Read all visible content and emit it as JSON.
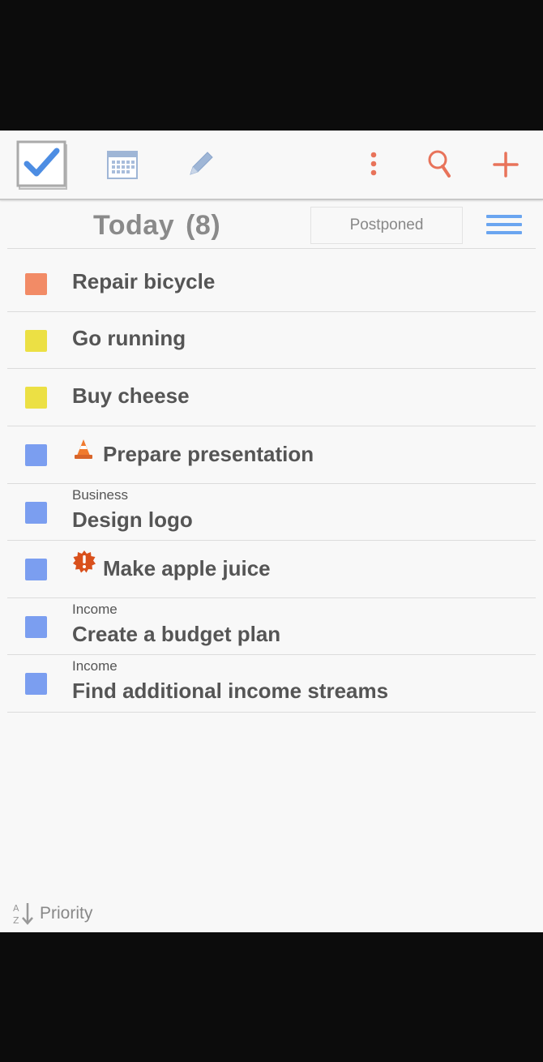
{
  "toolbar": {
    "icons": [
      "tasks-checkbox-icon",
      "calendar-icon",
      "pencil-icon",
      "more-vert-icon",
      "search-icon",
      "add-icon"
    ],
    "accent": "#e8735a"
  },
  "header": {
    "title": "Today",
    "count": "(8)",
    "postponed_label": "Postponed"
  },
  "tasks": [
    {
      "title": "Repair bicycle",
      "category": "",
      "color": "#f28b66",
      "badge": ""
    },
    {
      "title": "Go running",
      "category": "",
      "color": "#ece044",
      "badge": ""
    },
    {
      "title": "Buy cheese",
      "category": "",
      "color": "#ece044",
      "badge": ""
    },
    {
      "title": "Prepare presentation",
      "category": "",
      "color": "#7b9ef0",
      "badge": "traffic-cone-icon"
    },
    {
      "title": "Design logo",
      "category": "Business",
      "color": "#7b9ef0",
      "badge": ""
    },
    {
      "title": "Make apple juice",
      "category": "",
      "color": "#7b9ef0",
      "badge": "alert-badge-icon"
    },
    {
      "title": "Create a budget plan",
      "category": "Income",
      "color": "#7b9ef0",
      "badge": ""
    },
    {
      "title": "Find additional income streams",
      "category": "Income",
      "color": "#7b9ef0",
      "badge": ""
    }
  ],
  "footer": {
    "sort_label": "Priority",
    "sort_icon": "sort-az-icon"
  }
}
